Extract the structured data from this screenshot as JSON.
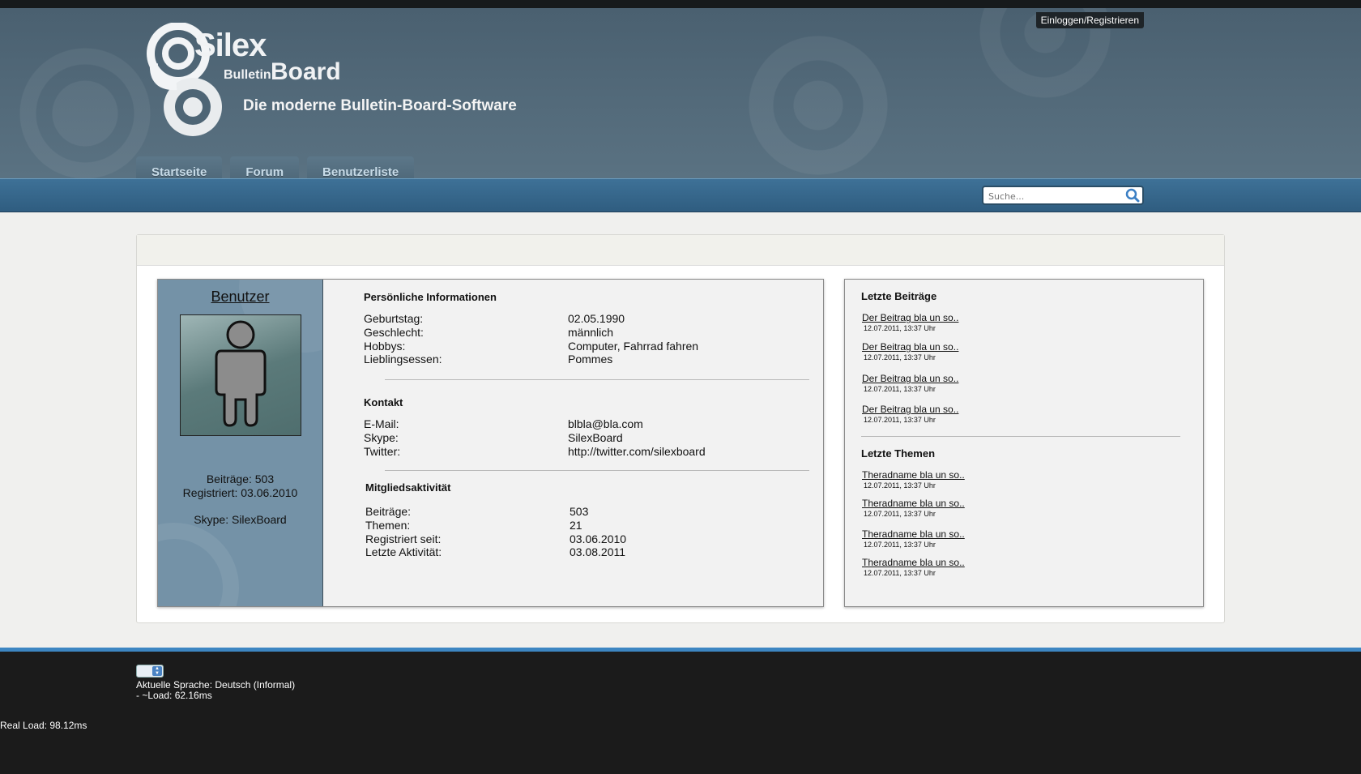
{
  "header": {
    "login_label": "Einloggen/Registrieren",
    "logo_silex": "Silex",
    "logo_bulletin": "Bulletin",
    "logo_board": "Board",
    "tagline": "Die moderne Bulletin-Board-Software"
  },
  "nav": {
    "tabs": [
      {
        "label": "Startseite"
      },
      {
        "label": "Forum"
      },
      {
        "label": "Benutzerliste"
      }
    ]
  },
  "search": {
    "placeholder": "Suche..."
  },
  "profile": {
    "username": "Benutzer",
    "posts_line": "Beiträge: 503",
    "registered_line": "Registriert: 03.06.2010",
    "skype_line": "Skype: SilexBoard"
  },
  "personal": {
    "title": "Persönliche Informationen",
    "rows": [
      {
        "label": "Geburtstag:",
        "value": "02.05.1990"
      },
      {
        "label": "Geschlecht:",
        "value": "männlich"
      },
      {
        "label": "Hobbys:",
        "value": "Computer, Fahrrad fahren"
      },
      {
        "label": "Lieblingsessen:",
        "value": "Pommes"
      }
    ]
  },
  "contact": {
    "title": "Kontakt",
    "rows": [
      {
        "label": "E-Mail:",
        "value": "blbla@bla.com"
      },
      {
        "label": "Skype:",
        "value": "SilexBoard"
      },
      {
        "label": "Twitter:",
        "value": "http://twitter.com/silexboard"
      }
    ]
  },
  "activity": {
    "title": "Mitgliedsaktivität",
    "rows": [
      {
        "label": "Beiträge:",
        "value": "503"
      },
      {
        "label": "Themen:",
        "value": "21"
      },
      {
        "label": "Registriert seit:",
        "value": "03.06.2010"
      },
      {
        "label": "Letzte Aktivität:",
        "value": "03.08.2011"
      }
    ]
  },
  "recent_posts": {
    "title": "Letzte Beiträge",
    "items": [
      {
        "link": "Der Beitrag bla un so..",
        "date": "12.07.2011, 13:37 Uhr"
      },
      {
        "link": "Der Beitrag bla un so..",
        "date": "12.07.2011, 13:37 Uhr"
      },
      {
        "link": "Der Beitrag bla un so..",
        "date": "12.07.2011, 13:37 Uhr"
      },
      {
        "link": "Der Beitrag bla un so..",
        "date": "12.07.2011, 13:37 Uhr"
      }
    ]
  },
  "recent_topics": {
    "title": "Letzte Themen",
    "items": [
      {
        "link": "Theradname bla un so..",
        "date": "12.07.2011, 13:37 Uhr"
      },
      {
        "link": "Theradname bla un so..",
        "date": "12.07.2011, 13:37 Uhr"
      },
      {
        "link": "Theradname bla un so..",
        "date": "12.07.2011, 13:37 Uhr"
      },
      {
        "link": "Theradname bla un so..",
        "date": "12.07.2011, 13:37 Uhr"
      }
    ]
  },
  "footer": {
    "language_line": "Aktuelle Sprache: Deutsch (Informal)",
    "load_line": "- ~Load: 62.16ms",
    "real_load_line": "Real Load: 98.12ms"
  },
  "colors": {
    "header_bg": "#4e6575",
    "nav_bar": "#3e7197",
    "sidebar_bg": "#7492a7",
    "footer_bg": "#1b1b1b",
    "footer_accent": "#3d86c2"
  },
  "icons": {
    "logo": "silex-spiral-logo",
    "search": "search-icon",
    "avatar": "default-user-avatar"
  }
}
